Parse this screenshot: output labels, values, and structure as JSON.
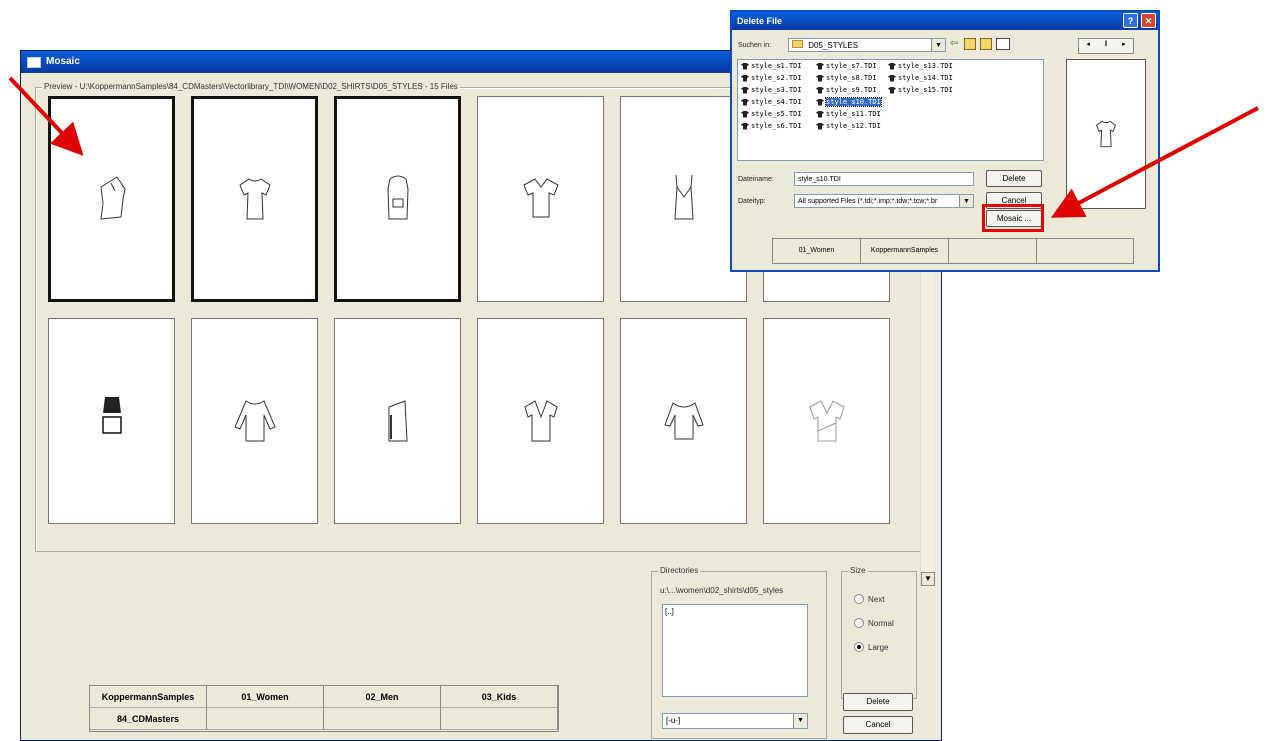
{
  "mosaic": {
    "title": "Mosaic",
    "preview_label": "Preview - U:\\KoppermannSamples\\84_CDMasters\\Vectorlibrary_TDI\\WOMEN\\D02_SHIRTS\\D05_STYLES - 15 Files",
    "directories": {
      "label": "Directories",
      "path": "u:\\...\\women\\d02_shirts\\d05_styles",
      "items": [
        "[..]"
      ],
      "drive": "[-u-]"
    },
    "size": {
      "label": "Size",
      "options": [
        "Next",
        "Normal",
        "Large"
      ],
      "selected": "Large"
    },
    "buttons": {
      "delete": "Delete",
      "cancel": "Cancel"
    },
    "tabs": [
      "KoppermannSamples",
      "01_Women",
      "02_Men",
      "03_Kids",
      "84_CDMasters",
      "",
      "",
      ""
    ]
  },
  "dialog": {
    "title": "Delete File",
    "look_in_label": "Suchen in:",
    "look_in_value": "D05_STYLES",
    "files": [
      "style_s1.TDI",
      "style_s2.TDI",
      "style_s3.TDI",
      "style_s4.TDI",
      "style_s5.TDI",
      "style_s6.TDI",
      "style_s7.TDI",
      "style_s8.TDI",
      "style_s9.TDI",
      "style_s10.TDI",
      "style_s11.TDI",
      "style_s12.TDI",
      "style_s13.TDI",
      "style_s14.TDI",
      "style_s15.TDI"
    ],
    "selected_file": "style_s10.TDI",
    "filename_label": "Dateiname:",
    "filename_value": "style_s10.TDI",
    "filetype_label": "Dateityp:",
    "filetype_value": "All supported Files (*.tdi;*.imp;*.tdw;*.tcw;*.br",
    "buttons": {
      "delete": "Delete",
      "cancel": "Cancel",
      "mosaic": "Mosaic ..."
    },
    "tabs": [
      "01_Women",
      "KoppermannSamples",
      "",
      ""
    ],
    "colors": {
      "highlight": "#e00000",
      "arrow": "#e00000"
    }
  }
}
